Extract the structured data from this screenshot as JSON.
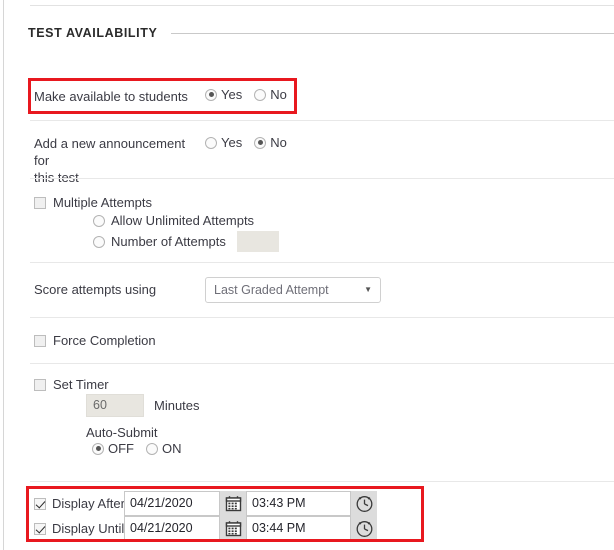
{
  "section": {
    "title": "TEST AVAILABILITY"
  },
  "make_available": {
    "label": "Make available to students",
    "options": [
      {
        "label": "Yes",
        "selected": true
      },
      {
        "label": "No",
        "selected": false
      }
    ]
  },
  "announcement": {
    "label_line1": "Add a new announcement for",
    "label_line2": "this test",
    "options": [
      {
        "label": "Yes",
        "selected": false
      },
      {
        "label": "No",
        "selected": true
      }
    ]
  },
  "multiple_attempts": {
    "label": "Multiple Attempts",
    "checked": false,
    "allow_unlimited": {
      "label": "Allow Unlimited Attempts",
      "selected": false
    },
    "number_of_attempts": {
      "label": "Number of Attempts",
      "selected": false,
      "value": ""
    }
  },
  "score_attempts": {
    "label": "Score attempts using",
    "selected": "Last Graded Attempt",
    "caret": "▼"
  },
  "force_completion": {
    "label": "Force Completion",
    "checked": false
  },
  "set_timer": {
    "label": "Set Timer",
    "checked": false,
    "minutes_value": "60",
    "minutes_label": "Minutes",
    "auto_submit_label": "Auto-Submit",
    "auto_submit_options": [
      {
        "label": "OFF",
        "selected": true
      },
      {
        "label": "ON",
        "selected": false
      }
    ]
  },
  "display_after": {
    "label": "Display After",
    "checked": true,
    "date": "04/21/2020",
    "time": "03:43 PM",
    "calendar_icon": "calendar-icon",
    "clock_icon": "clock-icon"
  },
  "display_until": {
    "label": "Display Until",
    "checked": true,
    "date": "04/21/2020",
    "time": "03:44 PM",
    "calendar_icon": "calendar-icon",
    "clock_icon": "clock-icon"
  },
  "colors": {
    "highlight": "#e8181f",
    "text": "#3b3b44",
    "separator": "#e8e8e8",
    "disabled_field": "#e8e6e0"
  }
}
